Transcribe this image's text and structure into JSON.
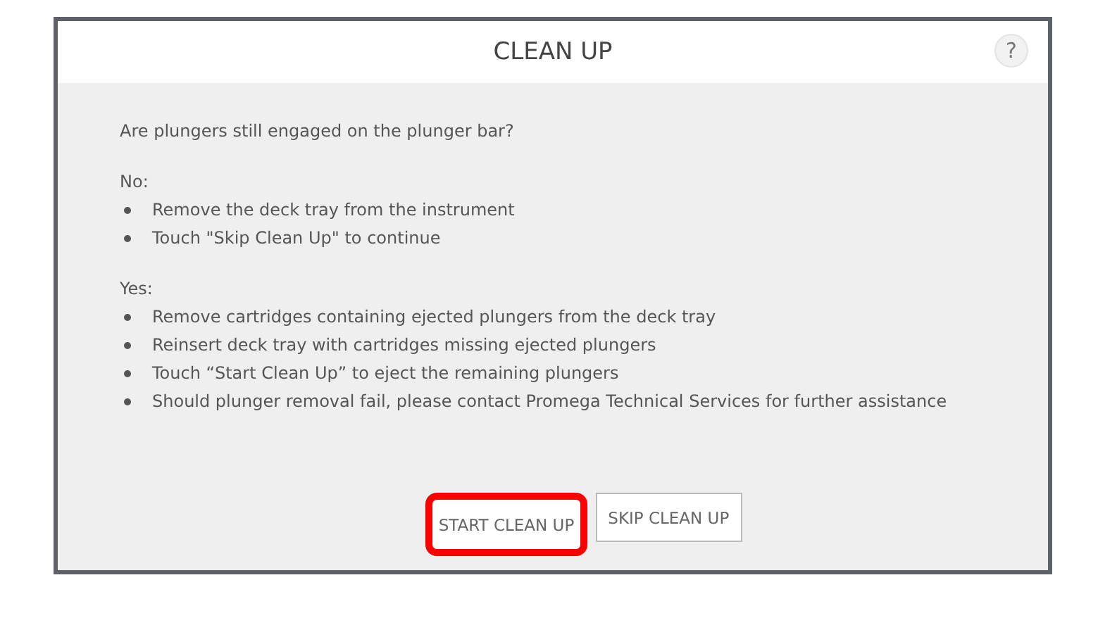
{
  "dialog": {
    "title": "CLEAN UP",
    "help": "?",
    "question": "Are plungers still engaged on the plunger bar?",
    "sections": [
      {
        "heading": "No:",
        "items": [
          "Remove the deck tray from the instrument",
          "Touch \"Skip Clean Up\" to continue"
        ]
      },
      {
        "heading": "Yes:",
        "items": [
          "Remove cartridges containing ejected plungers from the deck tray",
          "Reinsert deck tray  with cartridges missing ejected plungers",
          "Touch “Start Clean Up” to eject the remaining plungers",
          "Should plunger removal fail, please contact Promega Technical Services for further assistance"
        ]
      }
    ],
    "buttons": [
      {
        "label": "START CLEAN UP",
        "highlighted": true
      },
      {
        "label": "SKIP CLEAN UP",
        "highlighted": false
      }
    ]
  }
}
